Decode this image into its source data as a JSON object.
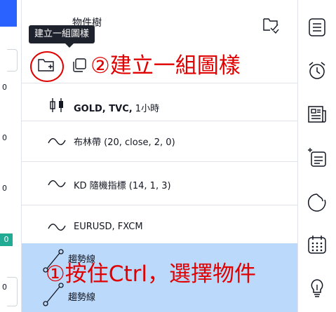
{
  "left_strip": {
    "ticks": [
      "0",
      "0",
      "0",
      "0",
      "0"
    ],
    "badge": "0"
  },
  "panel": {
    "title": "物件樹",
    "tooltip": "建立一組圖樣"
  },
  "annotations": {
    "step2": "②建立一組圖樣",
    "step1": "①按住Ctrl，選擇物件"
  },
  "objects": [
    {
      "icon": "candlestick-icon",
      "bold": "GOLD, TVC,",
      "rest": " 1小時"
    },
    {
      "icon": "wave-icon",
      "bold": "",
      "rest": "布林帶 (20, close, 2, 0)"
    },
    {
      "icon": "wave-icon",
      "bold": "",
      "rest": "KD 隨機指標 (14, 1, 3)"
    },
    {
      "icon": "wave-icon",
      "bold": "",
      "rest": "EURUSD, FXCM"
    }
  ],
  "selected_items": [
    {
      "icon": "trendline-icon",
      "label": "趨勢線"
    },
    {
      "icon": "trendline-icon",
      "label": "趨勢線"
    }
  ],
  "right_toolbar": [
    "watchlist-icon",
    "alarm-clock-icon",
    "news-icon",
    "calendar-add-icon",
    "hotlist-icon",
    "calendar-icon",
    "lightbulb-icon"
  ],
  "colors": {
    "selection": "#bbd9fb",
    "annotation": "#e00000",
    "tooltip_bg": "#1e222d",
    "accent": "#2962ff"
  }
}
